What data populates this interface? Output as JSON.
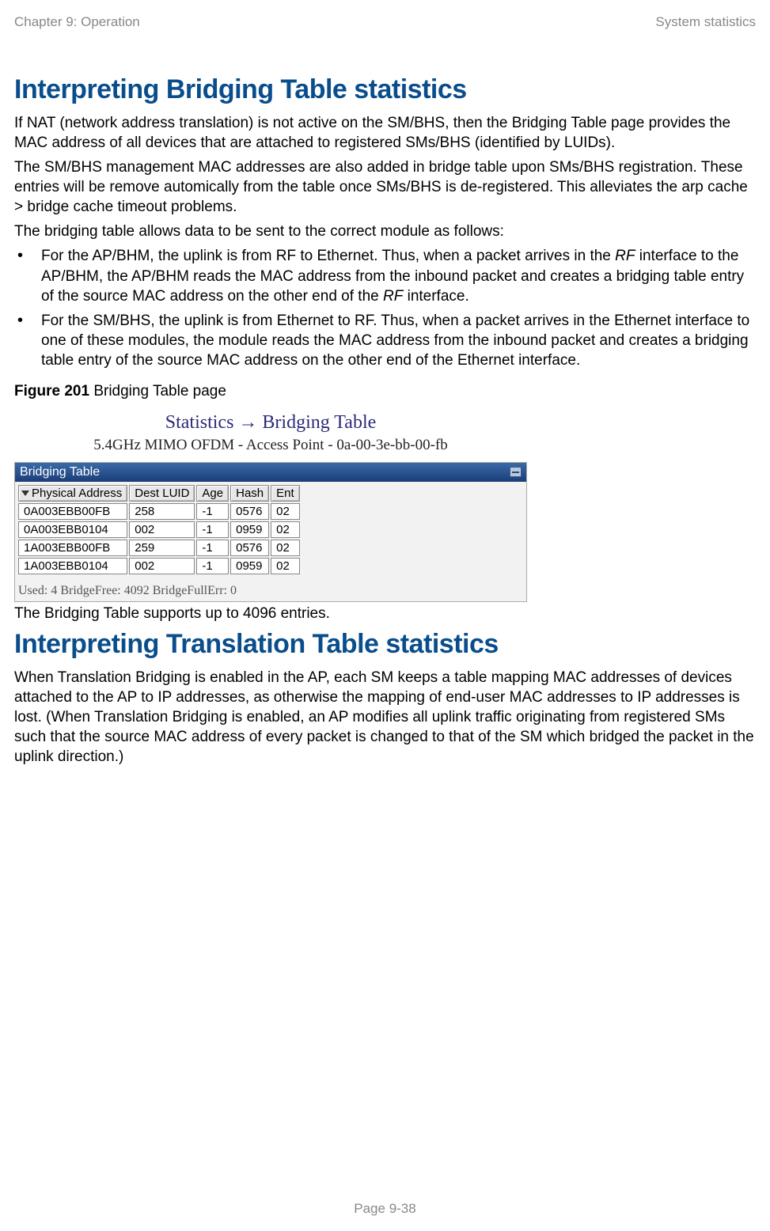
{
  "header": {
    "left": "Chapter 9:  Operation",
    "right": "System statistics"
  },
  "section1": {
    "title": "Interpreting Bridging Table statistics",
    "p1": "If NAT (network address translation) is not active on the SM/BHS, then the Bridging Table page provides the MAC address of all devices that are attached to registered SMs/BHS (identified by LUIDs).",
    "p2": "The SM/BHS management MAC addresses are also added in bridge table upon SMs/BHS registration. These entries will be remove automically from the table once SMs/BHS is de-registered. This alleviates the arp cache > bridge cache timeout problems.",
    "p3": "The bridging table allows data to be sent to the correct module as follows:",
    "bullet1_a": "For the AP/BHM, the uplink is from RF to Ethernet. Thus, when a packet arrives in the ",
    "bullet1_b": "RF",
    "bullet1_c": " interface to the AP/BHM, the AP/BHM reads the MAC address from the inbound packet and creates a bridging table entry of the source MAC address on the other end of the ",
    "bullet1_d": "RF",
    "bullet1_e": " interface.",
    "bullet2": "For the SM/BHS, the uplink is from Ethernet to RF. Thus, when a packet arrives in the Ethernet interface to one of these modules, the module reads the MAC address from the inbound packet and creates a bridging table entry of the source MAC address on the other end of the Ethernet interface."
  },
  "figure": {
    "caption_bold": "Figure 201",
    "caption_rest": " Bridging Table page",
    "title_left": "Statistics ",
    "title_arrow": "→",
    "title_right": " Bridging Table",
    "subtitle": "5.4GHz MIMO OFDM - Access Point - 0a-00-3e-bb-00-fb",
    "panel_title": "Bridging Table",
    "headers": [
      "Physical Address",
      "Dest LUID",
      "Age",
      "Hash",
      "Ent"
    ],
    "rows": [
      [
        "0A003EBB00FB",
        "258",
        "-1",
        "0576",
        "02"
      ],
      [
        "0A003EBB0104",
        "002",
        "-1",
        "0959",
        "02"
      ],
      [
        "1A003EBB00FB",
        "259",
        "-1",
        "0576",
        "02"
      ],
      [
        "1A003EBB0104",
        "002",
        "-1",
        "0959",
        "02"
      ]
    ],
    "footer": "Used: 4 BridgeFree: 4092 BridgeFullErr: 0",
    "after": "The Bridging Table supports up to 4096 entries."
  },
  "section2": {
    "title": "Interpreting Translation Table statistics",
    "p1": "When Translation Bridging is enabled in the AP, each SM keeps a table mapping MAC addresses of devices attached to the AP to IP addresses, as otherwise the mapping of end-user MAC addresses to IP addresses is lost. (When Translation Bridging is enabled, an AP modifies all uplink traffic originating from registered SMs such that the source MAC address of every packet is changed to that of the SM which bridged the packet in the uplink direction.)"
  },
  "pagefoot": "Page 9-38"
}
